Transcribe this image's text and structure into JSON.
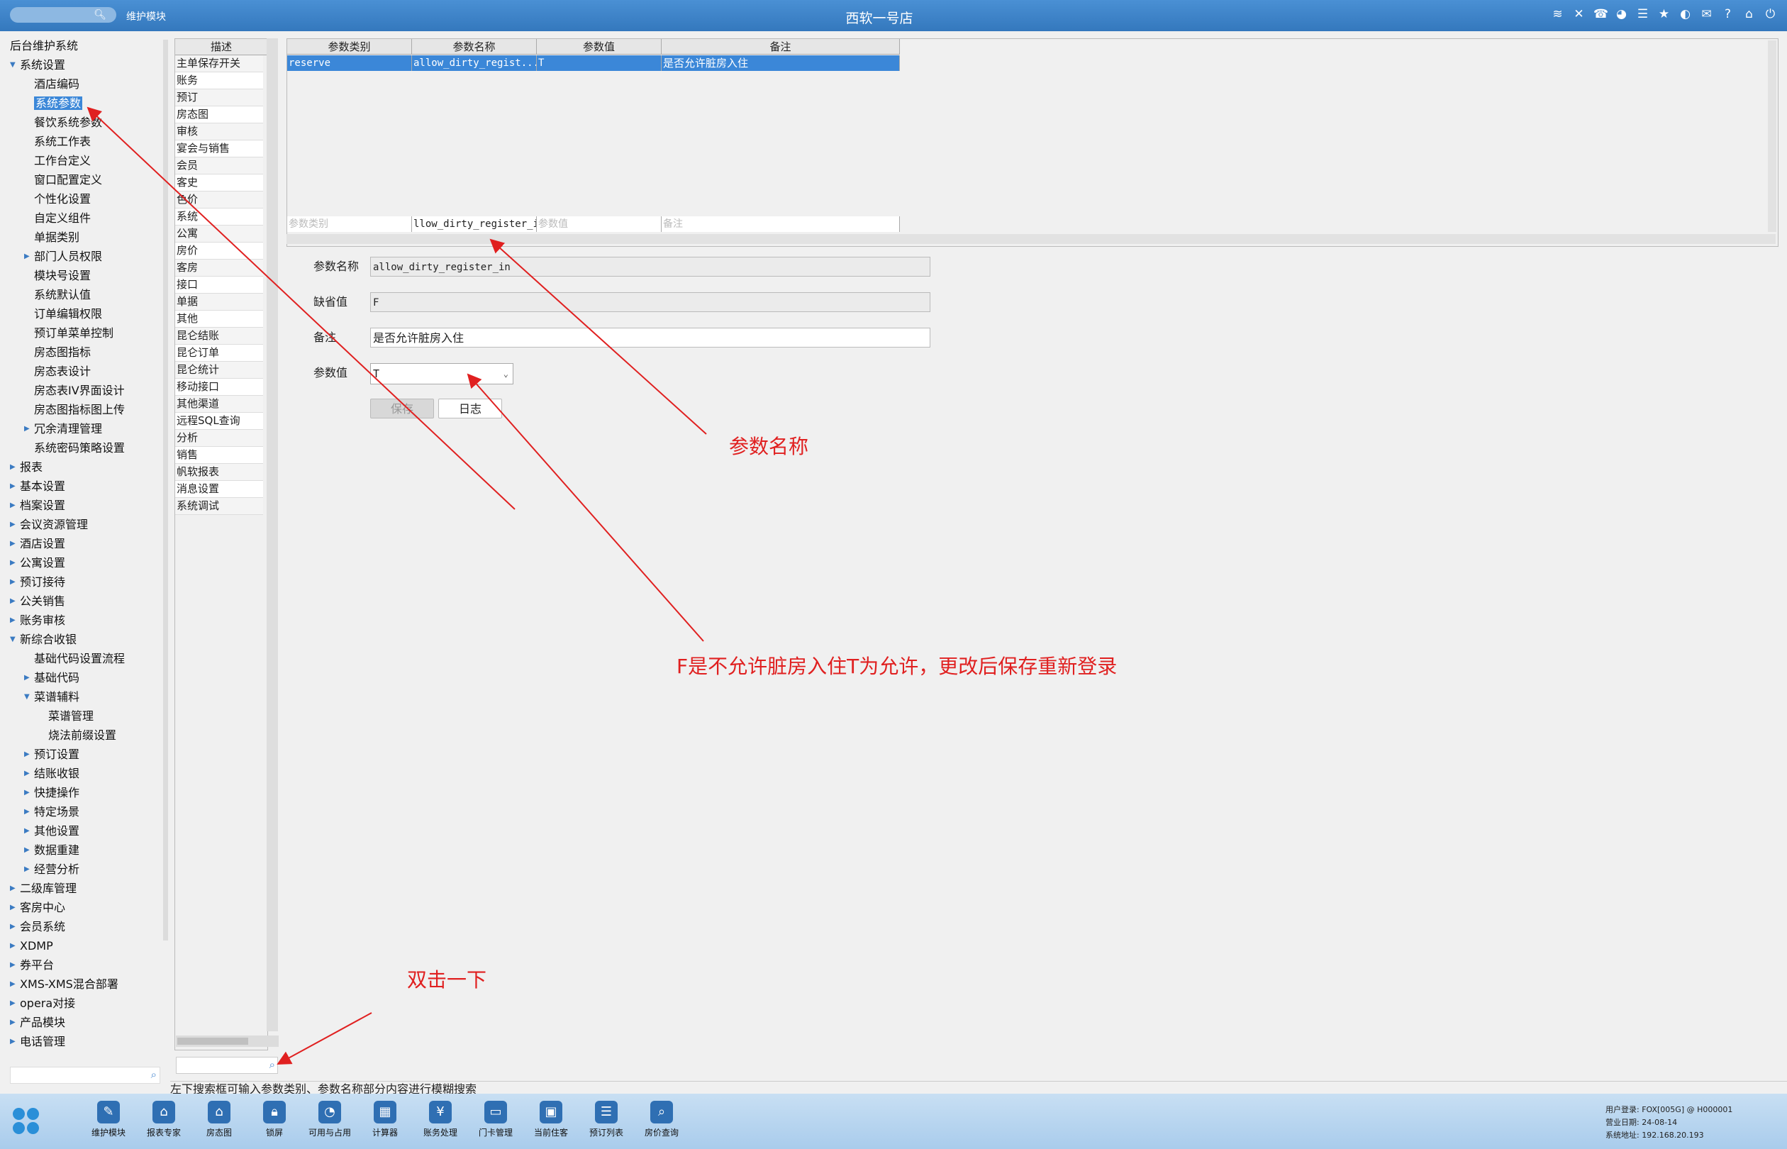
{
  "topbar": {
    "module": "维护模块",
    "title": "西软一号店",
    "icons": [
      "wifi-icon",
      "tools-icon",
      "phone-icon",
      "palette-icon",
      "menu-icon",
      "star-icon",
      "contrast-icon",
      "mail-icon",
      "help-icon",
      "home-icon",
      "power-icon"
    ]
  },
  "tree": [
    {
      "label": "后台维护系统",
      "level": 0,
      "arrow": ""
    },
    {
      "label": "系统设置",
      "level": 1,
      "arrow": "▼"
    },
    {
      "label": "酒店编码",
      "level": 2,
      "arrow": ""
    },
    {
      "label": "系统参数",
      "level": 2,
      "arrow": "",
      "selected": true
    },
    {
      "label": "餐饮系统参数",
      "level": 2,
      "arrow": ""
    },
    {
      "label": "系统工作表",
      "level": 2,
      "arrow": ""
    },
    {
      "label": "工作台定义",
      "level": 2,
      "arrow": ""
    },
    {
      "label": "窗口配置定义",
      "level": 2,
      "arrow": ""
    },
    {
      "label": "个性化设置",
      "level": 2,
      "arrow": ""
    },
    {
      "label": "自定义组件",
      "level": 2,
      "arrow": ""
    },
    {
      "label": "单据类别",
      "level": 2,
      "arrow": ""
    },
    {
      "label": "部门人员权限",
      "level": 2,
      "arrow": "▶"
    },
    {
      "label": "模块号设置",
      "level": 2,
      "arrow": ""
    },
    {
      "label": "系统默认值",
      "level": 2,
      "arrow": ""
    },
    {
      "label": "订单编辑权限",
      "level": 2,
      "arrow": ""
    },
    {
      "label": "预订单菜单控制",
      "level": 2,
      "arrow": ""
    },
    {
      "label": "房态图指标",
      "level": 2,
      "arrow": ""
    },
    {
      "label": "房态表设计",
      "level": 2,
      "arrow": ""
    },
    {
      "label": "房态表IV界面设计",
      "level": 2,
      "arrow": ""
    },
    {
      "label": "房态图指标图上传",
      "level": 2,
      "arrow": ""
    },
    {
      "label": "冗余清理管理",
      "level": 2,
      "arrow": "▶"
    },
    {
      "label": "系统密码策略设置",
      "level": 2,
      "arrow": ""
    },
    {
      "label": "报表",
      "level": 1,
      "arrow": "▶"
    },
    {
      "label": "基本设置",
      "level": 1,
      "arrow": "▶"
    },
    {
      "label": "档案设置",
      "level": 1,
      "arrow": "▶"
    },
    {
      "label": "会议资源管理",
      "level": 1,
      "arrow": "▶"
    },
    {
      "label": "酒店设置",
      "level": 1,
      "arrow": "▶"
    },
    {
      "label": "公寓设置",
      "level": 1,
      "arrow": "▶"
    },
    {
      "label": "预订接待",
      "level": 1,
      "arrow": "▶"
    },
    {
      "label": "公关销售",
      "level": 1,
      "arrow": "▶"
    },
    {
      "label": "账务审核",
      "level": 1,
      "arrow": "▶"
    },
    {
      "label": "新综合收银",
      "level": 1,
      "arrow": "▼"
    },
    {
      "label": "基础代码设置流程",
      "level": 2,
      "arrow": ""
    },
    {
      "label": "基础代码",
      "level": 2,
      "arrow": "▶"
    },
    {
      "label": "菜谱辅料",
      "level": 2,
      "arrow": "▼"
    },
    {
      "label": "菜谱管理",
      "level": 3,
      "arrow": ""
    },
    {
      "label": "烧法前缀设置",
      "level": 3,
      "arrow": ""
    },
    {
      "label": "预订设置",
      "level": 2,
      "arrow": "▶"
    },
    {
      "label": "结账收银",
      "level": 2,
      "arrow": "▶"
    },
    {
      "label": "快捷操作",
      "level": 2,
      "arrow": "▶"
    },
    {
      "label": "特定场景",
      "level": 2,
      "arrow": "▶"
    },
    {
      "label": "其他设置",
      "level": 2,
      "arrow": "▶"
    },
    {
      "label": "数据重建",
      "level": 2,
      "arrow": "▶"
    },
    {
      "label": "经营分析",
      "level": 2,
      "arrow": "▶"
    },
    {
      "label": "二级库管理",
      "level": 1,
      "arrow": "▶"
    },
    {
      "label": "客房中心",
      "level": 1,
      "arrow": "▶"
    },
    {
      "label": "会员系统",
      "level": 1,
      "arrow": "▶"
    },
    {
      "label": "XDMP",
      "level": 1,
      "arrow": "▶"
    },
    {
      "label": "券平台",
      "level": 1,
      "arrow": "▶"
    },
    {
      "label": "XMS-XMS混合部署",
      "level": 1,
      "arrow": "▶"
    },
    {
      "label": "opera对接",
      "level": 1,
      "arrow": "▶"
    },
    {
      "label": "产品模块",
      "level": 1,
      "arrow": "▶"
    },
    {
      "label": "电话管理",
      "level": 1,
      "arrow": "▶"
    }
  ],
  "midlist": {
    "header": "描述",
    "rows": [
      "主单保存开关",
      "账务",
      "预订",
      "房态图",
      "审核",
      "宴会与销售",
      "会员",
      "客史",
      "色价",
      "系统",
      "公寓",
      "房价",
      "客房",
      "接口",
      "单据",
      "其他",
      "昆仑结账",
      "昆仑订单",
      "昆仑统计",
      "移动接口",
      "其他渠道",
      "远程SQL查询",
      "分析",
      "销售",
      "帆软报表",
      "消息设置",
      "系统调试"
    ]
  },
  "grid": {
    "headers": [
      "参数类别",
      "参数名称",
      "参数值",
      "备注"
    ],
    "row": {
      "category": "reserve",
      "name": "allow_dirty_regist...",
      "value": "T",
      "note": "是否允许脏房入住"
    },
    "filter": {
      "category": "参数类别",
      "name": "llow_dirty_register_in",
      "value": "参数值",
      "note": "备注"
    }
  },
  "form": {
    "name_label": "参数名称",
    "name_value": "allow_dirty_register_in",
    "default_label": "缺省值",
    "default_value": "F",
    "note_label": "备注",
    "note_value": "是否允许脏房入住",
    "value_label": "参数值",
    "value_selected": "T",
    "save_label": "保存",
    "log_label": "日志"
  },
  "annotations": {
    "a1": "参数名称",
    "a2": "F是不允许脏房入住T为允许，更改后保存重新登录",
    "a3": "双击一下"
  },
  "status": "左下搜索框可输入参数类别、参数名称部分内容进行模糊搜索",
  "taskbar": [
    {
      "label": "维护模块",
      "icon": "wrench-icon"
    },
    {
      "label": "报表专家",
      "icon": "graduation-icon"
    },
    {
      "label": "房态图",
      "icon": "building-icon"
    },
    {
      "label": "锁屏",
      "icon": "lock-icon"
    },
    {
      "label": "可用与占用",
      "icon": "pie-icon"
    },
    {
      "label": "计算器",
      "icon": "calculator-icon"
    },
    {
      "label": "账务处理",
      "icon": "money-icon"
    },
    {
      "label": "门卡管理",
      "icon": "card-icon"
    },
    {
      "label": "当前住客",
      "icon": "guest-icon"
    },
    {
      "label": "预订列表",
      "icon": "list-icon"
    },
    {
      "label": "房价查询",
      "icon": "search-doc-icon"
    }
  ],
  "sysinfo": {
    "user": "用户登录:  FOX[005G] @ H000001",
    "date": "营业日期:  24-08-14",
    "addr": "系统地址:  192.168.20.193"
  }
}
